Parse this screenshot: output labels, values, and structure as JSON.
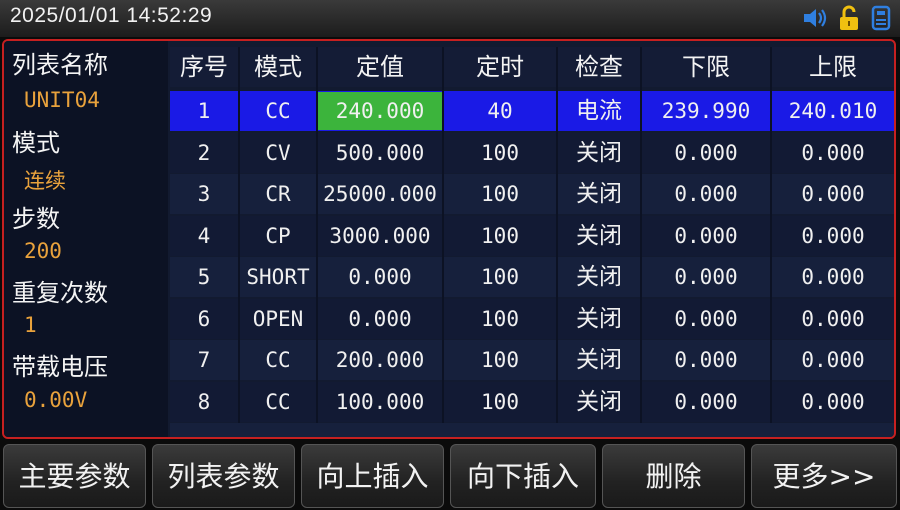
{
  "status_bar": {
    "datetime": "2025/01/01   14:52:29",
    "icons": [
      "speaker-icon",
      "unlock-icon",
      "usb-storage-icon"
    ],
    "colors": {
      "speaker": "#2f7fe0",
      "lock": "#f0c010",
      "storage": "#2f7fe0"
    }
  },
  "side_panel": [
    {
      "label": "列表名称",
      "value": "UNIT04"
    },
    {
      "label": "模式",
      "value": "连续"
    },
    {
      "label": "步数",
      "value": "200"
    },
    {
      "label": "重复次数",
      "value": "1"
    },
    {
      "label": "带载电压",
      "value": "0.00V"
    }
  ],
  "table": {
    "headers": [
      "序号",
      "模式",
      "定值",
      "定时",
      "检查",
      "下限",
      "上限"
    ],
    "rows": [
      [
        "1",
        "CC",
        "240.000",
        "40",
        "电流",
        "239.990",
        "240.010"
      ],
      [
        "2",
        "CV",
        "500.000",
        "100",
        "关闭",
        "0.000",
        "0.000"
      ],
      [
        "3",
        "CR",
        "25000.000",
        "100",
        "关闭",
        "0.000",
        "0.000"
      ],
      [
        "4",
        "CP",
        "3000.000",
        "100",
        "关闭",
        "0.000",
        "0.000"
      ],
      [
        "5",
        "SHORT",
        "0.000",
        "100",
        "关闭",
        "0.000",
        "0.000"
      ],
      [
        "6",
        "OPEN",
        "0.000",
        "100",
        "关闭",
        "0.000",
        "0.000"
      ],
      [
        "7",
        "CC",
        "200.000",
        "100",
        "关闭",
        "0.000",
        "0.000"
      ],
      [
        "8",
        "CC",
        "100.000",
        "100",
        "关闭",
        "0.000",
        "0.000"
      ]
    ],
    "selected_row": 0,
    "selected_cell_color": "#3cb43c",
    "selected_row_color": "#1a1ae6",
    "border_color": "#c62020"
  },
  "soft_keys": [
    "主要参数",
    "列表参数",
    "向上插入",
    "向下插入",
    "删除",
    "更多>>"
  ]
}
